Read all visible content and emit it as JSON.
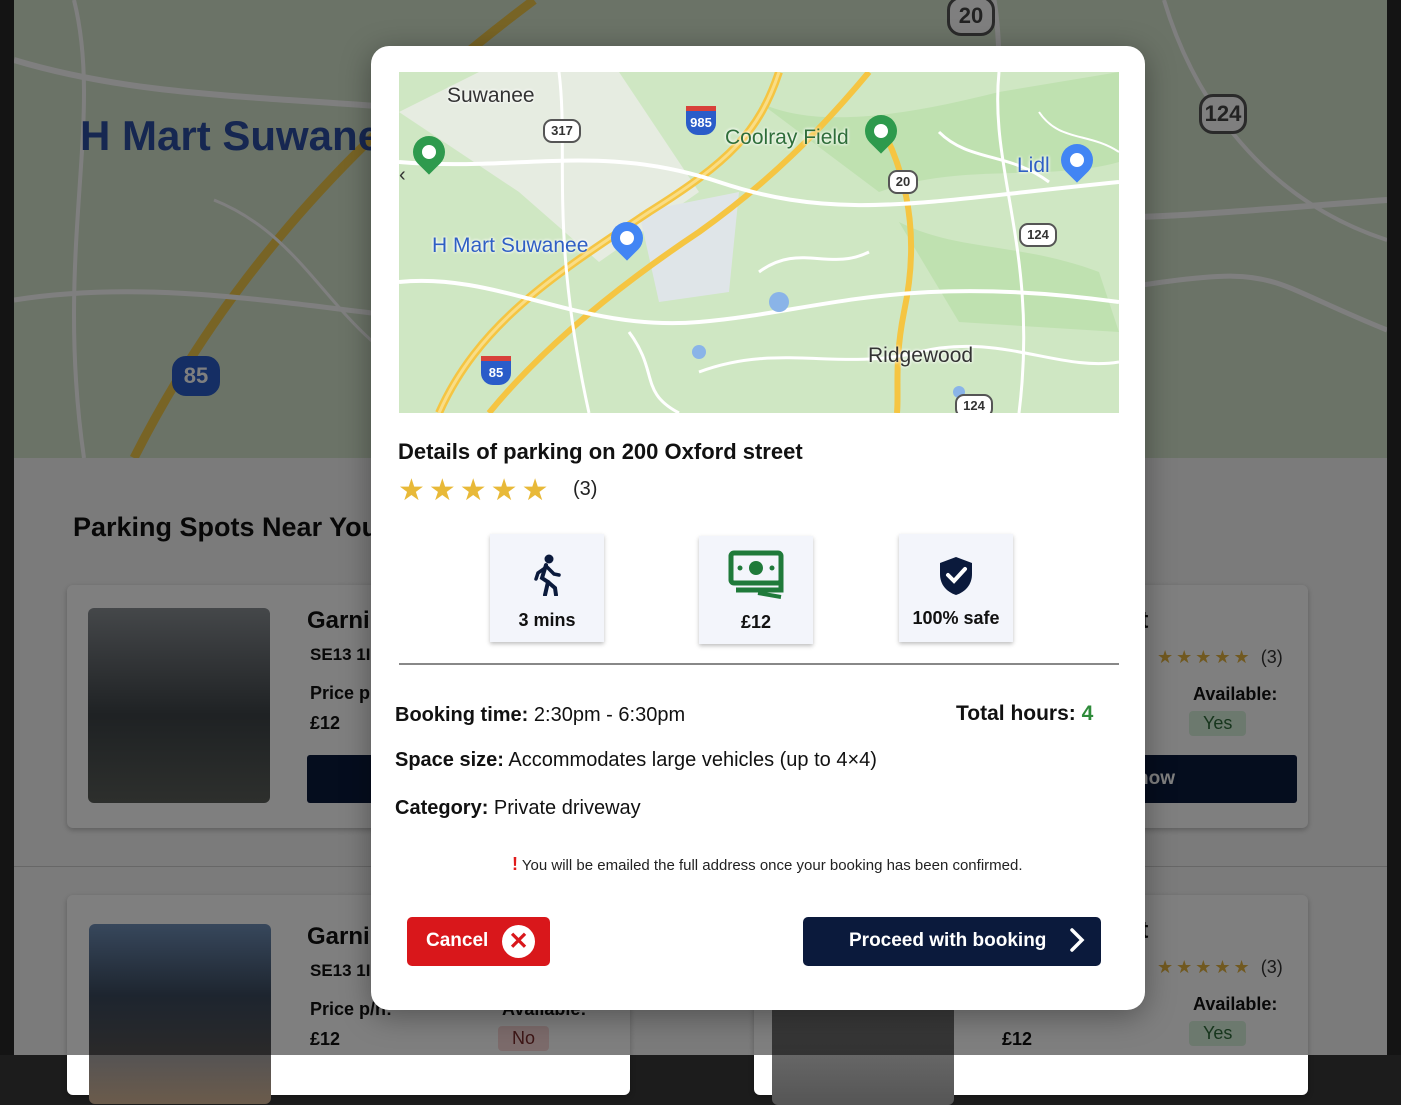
{
  "background": {
    "map_label": "H Mart Suwanee",
    "shields": [
      "20",
      "124",
      "85"
    ],
    "heading": "Parking Spots Near You",
    "cards": [
      {
        "title": "Garni",
        "postcode": "SE13 1I",
        "price_label": "Price p",
        "price": "£12",
        "right_title": "et",
        "stars": "★★★★★",
        "reviews": "(3)",
        "available_label": "Available:",
        "available": "Yes",
        "button": "now"
      },
      {
        "title": "Garni",
        "postcode": "SE13 1I",
        "price_label": "Price p/h:",
        "price": "£12",
        "mid_available_label": "Available:",
        "mid_available": "No",
        "price2": "£12",
        "right_title": "et",
        "stars": "★★★★★",
        "reviews": "(3)",
        "available_label": "Available:",
        "available": "Yes"
      }
    ]
  },
  "modal": {
    "map": {
      "labels": {
        "suwanee": "Suwanee",
        "coolray": "Coolray Field",
        "lidl": "Lidl",
        "hmart": "H Mart Suwanee",
        "ridgewood": "Ridgewood"
      },
      "shields": {
        "r317": "317",
        "i985": "985",
        "r20": "20",
        "r124a": "124",
        "i85": "85",
        "r124b": "124"
      },
      "prev_arrow": "‹"
    },
    "title": "Details of parking on 200 Oxford street",
    "rating": {
      "stars": "★★★★★",
      "count": "(3)"
    },
    "features": [
      {
        "label": "3 mins",
        "icon": "walking-icon"
      },
      {
        "label": "£12",
        "icon": "cash-icon"
      },
      {
        "label": "100% safe",
        "icon": "shield-check-icon"
      }
    ],
    "booking": {
      "time_label": "Booking time:",
      "time_value": "2:30pm - 6:30pm",
      "total_label": "Total hours:",
      "total_value": "4",
      "size_label": "Space size:",
      "size_value": "Accommodates large vehicles (up to 4×4)",
      "category_label": "Category:",
      "category_value": "Private driveway"
    },
    "notice": {
      "mark": "!",
      "text": "You will be emailed the full address once your booking has been confirmed."
    },
    "buttons": {
      "cancel": "Cancel",
      "cancel_icon": "✕",
      "proceed": "Proceed with booking",
      "proceed_icon": "›"
    },
    "colors": {
      "primary": "#0b1a3c",
      "danger": "#d9171b",
      "star": "#e8b938",
      "success": "#2e8b3a"
    }
  }
}
